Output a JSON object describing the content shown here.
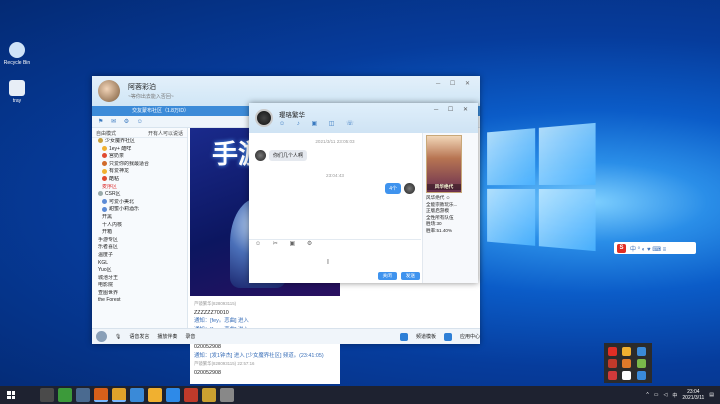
{
  "desktop": {
    "icons": [
      {
        "label": "Recycle Bin",
        "color": "#cfe3f7"
      },
      {
        "label": "tray",
        "color": "#e7eef6"
      }
    ]
  },
  "main": {
    "user_name": "阿蓉彩泊",
    "signature": "~等你出去能入否回~",
    "room_bar": "交友蒙布社区（1.8万ID）",
    "sidebar_head": {
      "mode": "自由模式",
      "action": "开有人可以说话"
    },
    "channels": [
      {
        "label": "少女魔界社区",
        "cls": "",
        "dot": "#c9a03b"
      },
      {
        "label": "1ey+ 酷咩",
        "cls": "sub",
        "dot": "#f0b030"
      },
      {
        "label": "宫奶茶",
        "cls": "sub",
        "dot": "#e04a30"
      },
      {
        "label": "只爱你的我最适合",
        "cls": "sub",
        "dot": "#d06a2a"
      },
      {
        "label": "有爱神龙",
        "cls": "sub",
        "dot": "#f0b030"
      },
      {
        "label": "酷粘",
        "cls": "sub",
        "dot": "#e04a30"
      },
      {
        "label": "麦序区",
        "cls": "sub red",
        "dot": ""
      },
      {
        "label": "CSR区",
        "cls": "",
        "dot": "#9aa"
      },
      {
        "label": "可爱小美北",
        "cls": "sub",
        "dot": "#5a8ad6"
      },
      {
        "label": "甜蜜小莉酒乐",
        "cls": "sub",
        "dot": "#5a8ad6"
      },
      {
        "label": "开黑",
        "cls": "sub",
        "dot": ""
      },
      {
        "label": "十人内核",
        "cls": "sub",
        "dot": ""
      },
      {
        "label": "开箱",
        "cls": "sub",
        "dot": ""
      },
      {
        "label": "手游专区",
        "cls": "",
        "dot": ""
      },
      {
        "label": "乐者喜区",
        "cls": "",
        "dot": ""
      },
      {
        "label": "温度子",
        "cls": "",
        "dot": ""
      },
      {
        "label": "KGL",
        "cls": "",
        "dot": ""
      },
      {
        "label": "Yuo区",
        "cls": "",
        "dot": ""
      },
      {
        "label": "城池牙王",
        "cls": "",
        "dot": ""
      },
      {
        "label": "电影院",
        "cls": "",
        "dot": ""
      },
      {
        "label": "查图世界",
        "cls": "",
        "dot": ""
      },
      {
        "label": "the Forest",
        "cls": "",
        "dot": ""
      }
    ],
    "video_title": "手游",
    "chat_log": [
      {
        "text": "芦镜繁华(828093115)",
        "cls": "meta"
      },
      {
        "text": "ZZZZZZ70010",
        "cls": ""
      },
      {
        "text": "通知：[fey。恋曲] 进入",
        "cls": "sys"
      },
      {
        "text": "通知：[fey。恋曲] 进入",
        "cls": "sys"
      },
      {
        "text": "fey。恋曲(582767614)",
        "cls": "meta"
      },
      {
        "text": "020052908",
        "cls": ""
      },
      {
        "text": "通知：[发1钟杰] 进入 [少女魔界社区] 频道。(23:41:05)",
        "cls": "sys"
      },
      {
        "text": "芦镜繁华(828093115) 22:57:16",
        "cls": "meta"
      },
      {
        "text": "020052908",
        "cls": ""
      }
    ],
    "bottom": {
      "label1": "语音发言",
      "label2": "播放伴奏",
      "label3": "录音",
      "label4": "频道模板",
      "label5": "应用中心"
    }
  },
  "chat": {
    "name": "璎珞繁华",
    "time1": "2021/3/11 23:05:03",
    "msg_in": "你们几个人啊",
    "time2": "23:04:43",
    "msg_out": "4个",
    "send_label": "发送",
    "close_label": "关闭",
    "cursor": "I",
    "card_title": "风华绝代",
    "card_lines": [
      "风华绝代 ☺",
      "全能宗教玩乐...",
      "正版启游模",
      "全性所有队伍",
      "胜场:30",
      "胜率:51.40%"
    ]
  },
  "ime": {
    "icon": "S",
    "items": "中 ⁰ ◐ ♥ ⌨ ≡"
  },
  "taskbar": {
    "time": "23:04",
    "date": "2021/3/11",
    "apps": [
      "#1e2230",
      "#4a4a4a",
      "#3c9a3a",
      "#4a6a90",
      "#d8601a",
      "#e0a22a",
      "#3a8ad8",
      "#f0b030",
      "#2e8ae8",
      "#c03a2a",
      "#caa030",
      "#888"
    ]
  }
}
